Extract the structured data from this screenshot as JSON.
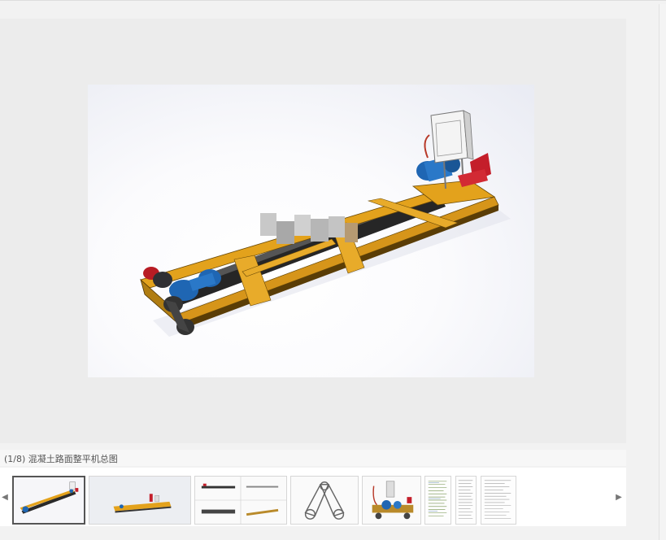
{
  "caption": {
    "text": "(1/8) 混凝土路面整平机总图"
  },
  "navigation": {
    "prev_icon": "◀",
    "next_icon": "▶"
  },
  "thumbnails": {
    "count": 8,
    "active_index": 0
  },
  "colors": {
    "frame_yellow": "#e3a21c",
    "motor_blue": "#1f66b3",
    "seat_red": "#c41e2a",
    "roller_dark": "#2a2a2a"
  }
}
